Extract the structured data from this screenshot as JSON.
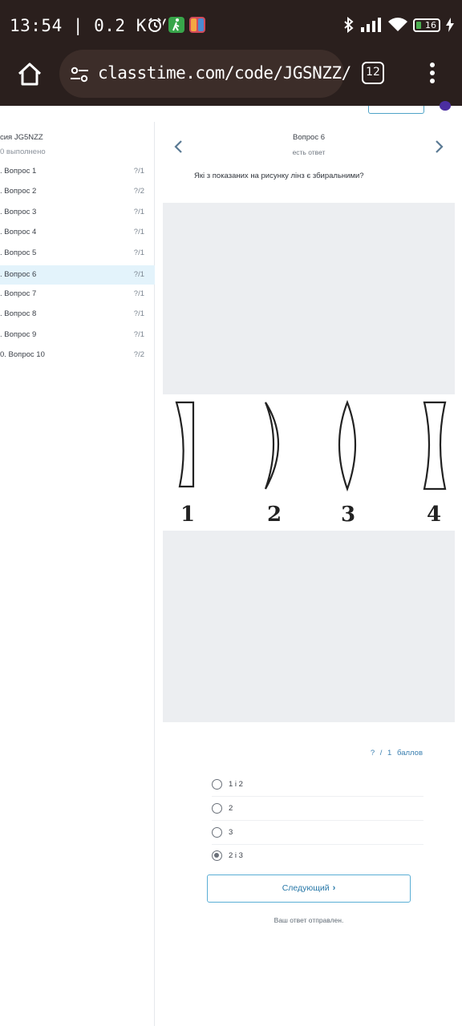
{
  "status_bar": {
    "time_speed": "13:54 | 0.2 КБ/с",
    "battery": "16",
    "colors": {
      "alarm_app": "#38a54a",
      "flash_app": "#d24a5a"
    }
  },
  "browser": {
    "url": "classtime.com/code/JGSNZZ/",
    "tab_count": "12"
  },
  "sidebar": {
    "session_title": "сия JG5NZZ",
    "progress": "0 выполнено",
    "questions": [
      {
        "label": "Вопрос 1",
        "score": "?/1"
      },
      {
        "label": "Вопрос 2",
        "score": "?/2"
      },
      {
        "label": "Вопрос 3",
        "score": "?/1"
      },
      {
        "label": "Вопрос 4",
        "score": "?/1"
      },
      {
        "label": "Вопрос 5",
        "score": "?/1"
      },
      {
        "label": "Вопрос 6",
        "score": "?/1"
      },
      {
        "label": "Вопрос 7",
        "score": "?/1"
      },
      {
        "label": "Вопрос 8",
        "score": "?/1"
      },
      {
        "label": "Вопрос 9",
        "score": "?/1"
      },
      {
        "label": "0. Вопрос 10",
        "score": "?/2"
      }
    ],
    "active_index": 5
  },
  "question": {
    "title": "Вопрос 6",
    "status": "есть ответ",
    "text": "Які з показаних на рисунку лінз є збиральними?",
    "figure_numbers": [
      "1",
      "2",
      "3",
      "4"
    ],
    "points": {
      "got": "?",
      "sep": "/",
      "max": "1",
      "unit": "баллов"
    },
    "options": [
      {
        "label": "1 і 2",
        "checked": false
      },
      {
        "label": "2",
        "checked": false
      },
      {
        "label": "3",
        "checked": false
      },
      {
        "label": "2 і 3",
        "checked": true
      }
    ],
    "next_label": "Следующий",
    "sent_message": "Ваш ответ отправлен."
  },
  "icons": {
    "home": "home-icon",
    "site_settings": "tune-icon",
    "menu": "more-vert-icon",
    "prev": "chevron-left-icon",
    "next": "chevron-right-icon"
  }
}
